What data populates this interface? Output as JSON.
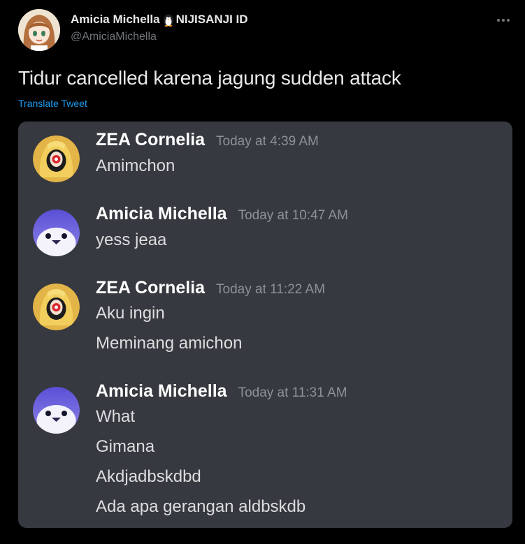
{
  "tweet": {
    "author_name": "Amicia Michella",
    "author_suffix": "NIJISANJI ID",
    "handle": "@AmiciaMichella",
    "text": "Tidur cancelled karena jagung sudden attack",
    "translate_label": "Translate Tweet",
    "more_icon": "more-horizontal-icon"
  },
  "discord": {
    "colors": {
      "background": "#36393f",
      "author": "#ffffff",
      "timestamp": "#8e9297",
      "text": "#dcddde"
    },
    "messages": [
      {
        "author": "ZEA Cornelia",
        "time": "Today at 4:39 AM",
        "avatar": "zea-avatar",
        "lines": [
          "Amimchon"
        ]
      },
      {
        "author": "Amicia Michella",
        "time": "Today at 10:47 AM",
        "avatar": "penguin-avatar",
        "lines": [
          "yess jeaa"
        ]
      },
      {
        "author": "ZEA Cornelia",
        "time": "Today at 11:22 AM",
        "avatar": "zea-avatar",
        "lines": [
          "Aku ingin",
          "Meminang amichon"
        ]
      },
      {
        "author": "Amicia Michella",
        "time": "Today at 11:31 AM",
        "avatar": "penguin-avatar",
        "lines": [
          "What",
          "Gimana",
          "Akdjadbskdbd",
          "Ada apa gerangan aldbskdb"
        ]
      }
    ]
  },
  "colors": {
    "page_background": "#000000",
    "primary_text": "#e7e9ea",
    "secondary_text": "#71767b",
    "link": "#1d9bf0"
  }
}
